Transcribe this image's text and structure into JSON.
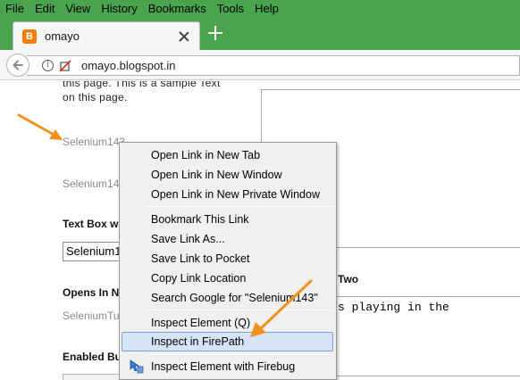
{
  "menubar": {
    "items": [
      "File",
      "Edit",
      "View",
      "History",
      "Bookmarks",
      "Tools",
      "Help"
    ]
  },
  "tab": {
    "title": "omayo",
    "favicon_letter": "B"
  },
  "navbar": {
    "url": "omayo.blogspot.in",
    "info_symbol": "i"
  },
  "page": {
    "para_line1": "this page. This is a sample Text",
    "para_line2": "on this page.",
    "link1": "Selenium143",
    "link2": "Selenium143",
    "textbox_label": "Text Box wi",
    "textbox_value": "Selenium1",
    "opens_label": "Opens In Ne",
    "selenium_tut": "SeleniumTut",
    "enabled_label": "Enabled But",
    "two_heading": "Two",
    "textarea_text": "s playing in the"
  },
  "context_menu": {
    "items": [
      "Open Link in New Tab",
      "Open Link in New Window",
      "Open Link in New Private Window",
      "Bookmark This Link",
      "Save Link As...",
      "Save Link to Pocket",
      "Copy Link Location",
      "Search Google for \"Selenium143\"",
      "Inspect Element (Q)",
      "Inspect in FirePath",
      "Inspect Element with Firebug"
    ],
    "highlighted_index": 9
  },
  "colors": {
    "menubar_bg": "#4aa34d",
    "arrow": "#f0921c",
    "highlight_bg": "#d5e5f7"
  }
}
